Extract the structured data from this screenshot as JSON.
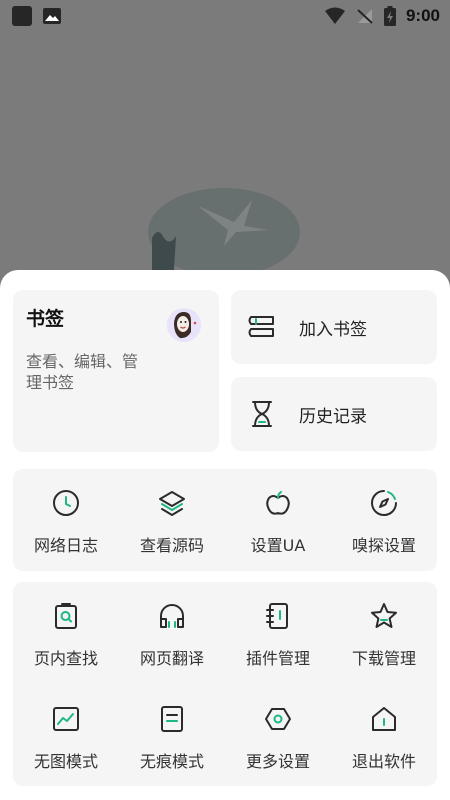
{
  "status_bar": {
    "time": "9:00"
  },
  "bookmark_card": {
    "title": "书签",
    "description": "查看、编辑、管理书签"
  },
  "quick_actions": [
    {
      "label": "加入书签",
      "icon": "add-bookmark-icon"
    },
    {
      "label": "历史记录",
      "icon": "hourglass-icon"
    }
  ],
  "tools_row": [
    {
      "label": "网络日志",
      "icon": "clock-icon"
    },
    {
      "label": "查看源码",
      "icon": "layers-icon"
    },
    {
      "label": "设置UA",
      "icon": "apple-icon"
    },
    {
      "label": "嗅探设置",
      "icon": "compass-icon"
    }
  ],
  "tools_grid": [
    {
      "label": "页内查找",
      "icon": "clipboard-search-icon"
    },
    {
      "label": "网页翻译",
      "icon": "headphones-icon"
    },
    {
      "label": "插件管理",
      "icon": "notebook-icon"
    },
    {
      "label": "下载管理",
      "icon": "star-icon"
    },
    {
      "label": "无图模式",
      "icon": "image-chart-icon"
    },
    {
      "label": "无痕模式",
      "icon": "document-icon"
    },
    {
      "label": "更多设置",
      "icon": "settings-hexagon-icon"
    },
    {
      "label": "退出软件",
      "icon": "home-exit-icon"
    }
  ],
  "colors": {
    "accent": "#1fb784",
    "icon_stroke": "#2b2b2b",
    "card_bg": "#f5f5f5"
  }
}
